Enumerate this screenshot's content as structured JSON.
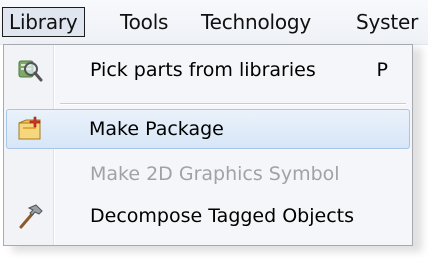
{
  "menubar": {
    "items": [
      {
        "label": "Library"
      },
      {
        "label": "Tools"
      },
      {
        "label": "Technology"
      },
      {
        "label": "Syster"
      }
    ]
  },
  "dropdown": {
    "items": [
      {
        "label": "Pick parts from libraries",
        "shortcut": "P",
        "icon": "library-search-icon",
        "enabled": true
      },
      {
        "label": "Make Package",
        "icon": "new-package-icon",
        "enabled": true,
        "highlighted": true
      },
      {
        "label": "Make 2D Graphics Symbol",
        "enabled": false
      },
      {
        "label": "Decompose Tagged Objects",
        "icon": "hammer-icon",
        "enabled": true
      }
    ]
  }
}
